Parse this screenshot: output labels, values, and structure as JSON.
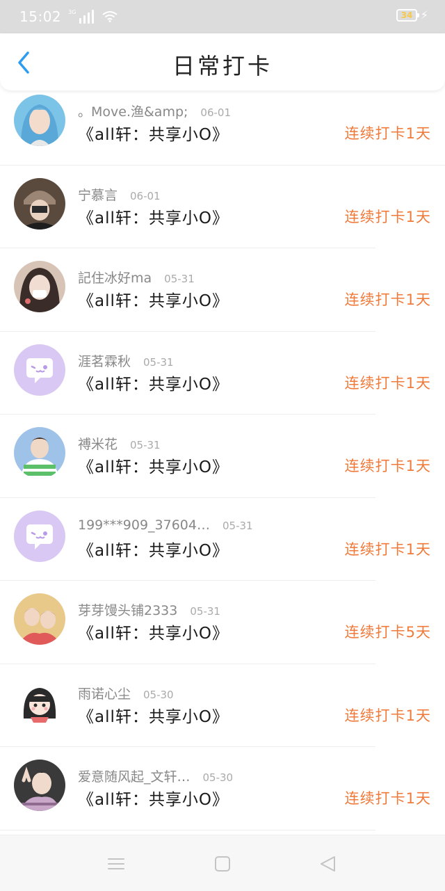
{
  "status_bar": {
    "time": "15:02",
    "network_label": "3G",
    "battery": "34",
    "icons": [
      "signal-icon",
      "wifi-icon",
      "battery-icon",
      "charging-icon"
    ]
  },
  "header": {
    "title": "日常打卡",
    "back_icon": "chevron-left-icon",
    "accent": "#2d9cf0"
  },
  "colors": {
    "streak": "#f07a3a",
    "username": "#888888",
    "date": "#aaaaaa"
  },
  "items": [
    {
      "username": "。Move.渔&amp;",
      "date": "06-01",
      "book": "《all轩：共享小O》",
      "streak": "连续打卡1天",
      "avatar": "blue-hair-girl"
    },
    {
      "username": "宁慕言",
      "date": "06-01",
      "book": "《all轩：共享小O》",
      "streak": "连续打卡1天",
      "avatar": "beanie-person"
    },
    {
      "username": "記住冰好ma",
      "date": "05-31",
      "book": "《all轩：共享小O》",
      "streak": "连续打卡1天",
      "avatar": "masked-girl"
    },
    {
      "username": "涯茗霖秋",
      "date": "05-31",
      "book": "《all轩：共享小O》",
      "streak": "连续打卡1天",
      "avatar": "default-chat"
    },
    {
      "username": "禣米花",
      "date": "05-31",
      "book": "《all轩：共享小O》",
      "streak": "连续打卡1天",
      "avatar": "green-striped-boy"
    },
    {
      "username": "199***909_37604…",
      "date": "05-31",
      "book": "《all轩：共享小O》",
      "streak": "连续打卡1天",
      "avatar": "default-chat"
    },
    {
      "username": "芽芽馒头铺2333",
      "date": "05-31",
      "book": "《all轩：共享小O》",
      "streak": "连续打卡5天",
      "avatar": "two-boys"
    },
    {
      "username": "雨诺心尘",
      "date": "05-30",
      "book": "《all轩：共享小O》",
      "streak": "连续打卡1天",
      "avatar": "cartoon-girl"
    },
    {
      "username": "爱意随风起_文轩…",
      "date": "05-30",
      "book": "《all轩：共享小O》",
      "streak": "连续打卡1天",
      "avatar": "peace-sign-boy"
    }
  ],
  "nav": {
    "icons": [
      "menu-icon",
      "home-icon",
      "back-icon"
    ]
  }
}
